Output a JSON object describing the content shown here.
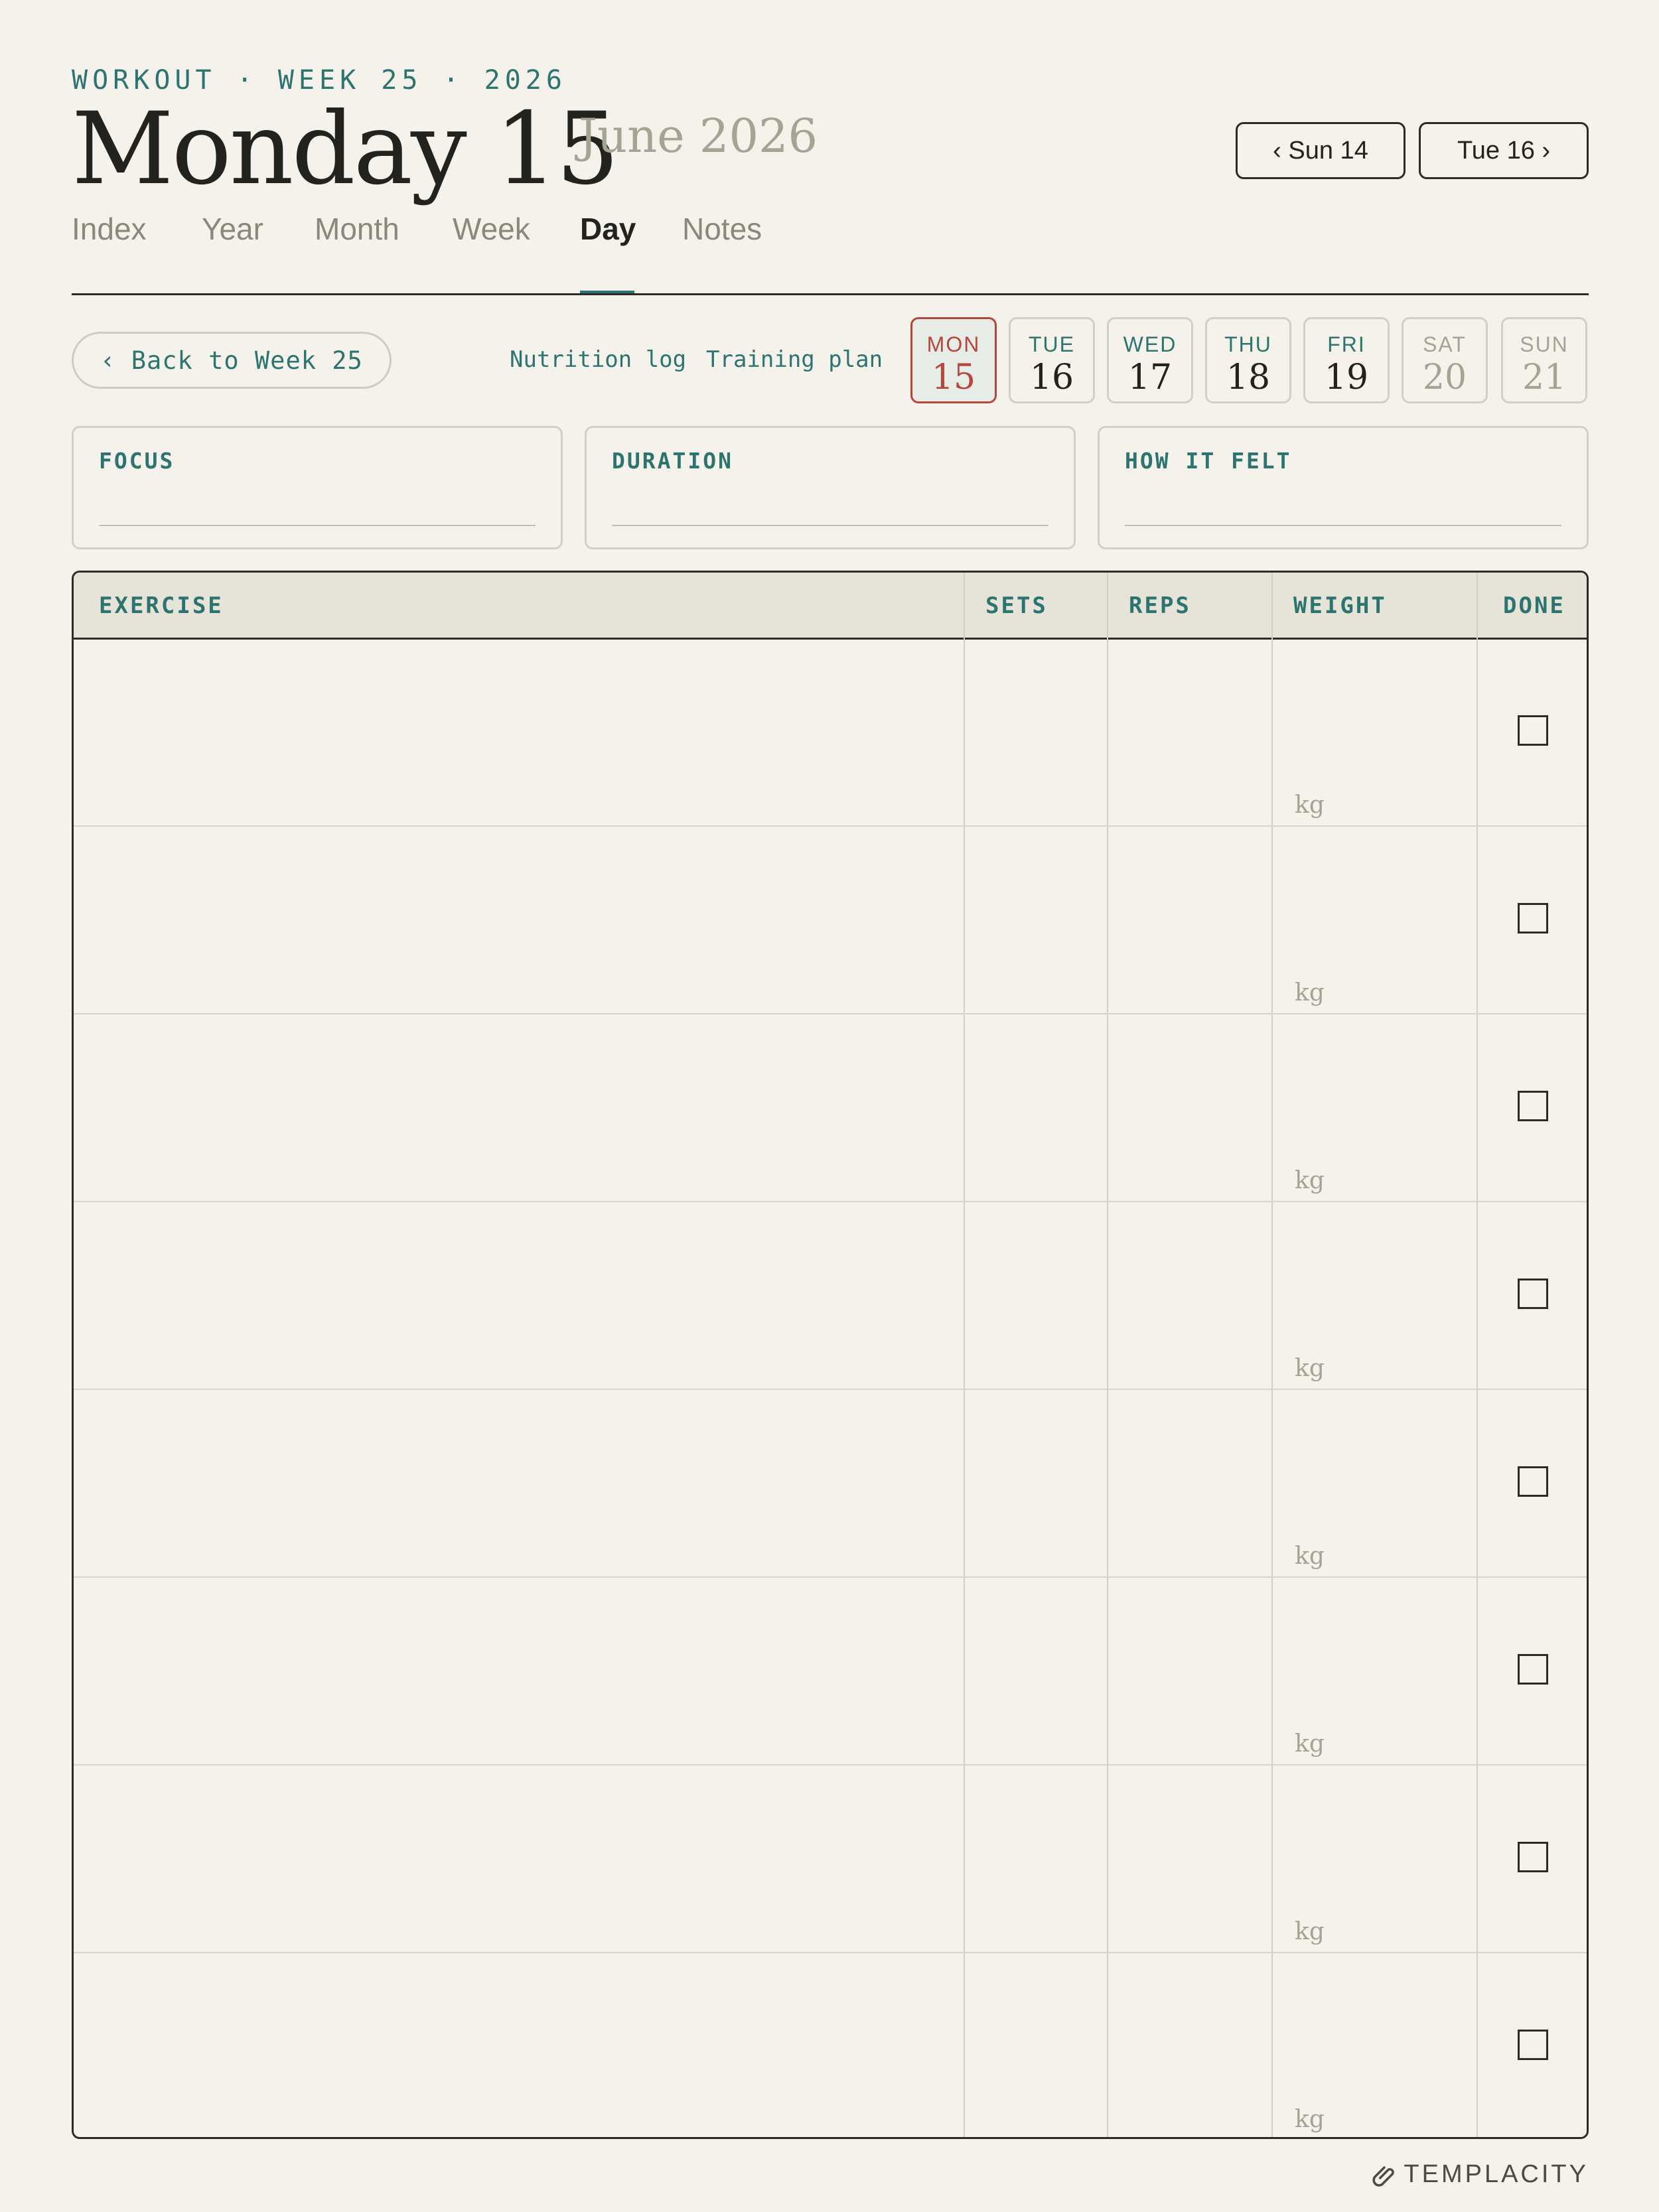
{
  "header": {
    "kicker": "WORKOUT · WEEK 25 · 2026",
    "title": "Monday 15",
    "subtitle": "June 2026",
    "prev_label": "‹ Sun 14",
    "next_label": "Tue 16 ›"
  },
  "tabs": [
    {
      "label": "Index"
    },
    {
      "label": "Year"
    },
    {
      "label": "Month"
    },
    {
      "label": "Week"
    },
    {
      "label": "Day",
      "active": true
    },
    {
      "label": "Notes"
    }
  ],
  "toolbar": {
    "back_label": "‹ Back to Week 25",
    "links": [
      "Nutrition log",
      "Training plan"
    ]
  },
  "days": [
    {
      "dow": "MON",
      "num": "15",
      "active": true
    },
    {
      "dow": "TUE",
      "num": "16"
    },
    {
      "dow": "WED",
      "num": "17"
    },
    {
      "dow": "THU",
      "num": "18"
    },
    {
      "dow": "FRI",
      "num": "19"
    },
    {
      "dow": "SAT",
      "num": "20",
      "weekend": true
    },
    {
      "dow": "SUN",
      "num": "21",
      "weekend": true
    }
  ],
  "fields": [
    {
      "label": "FOCUS",
      "value": ""
    },
    {
      "label": "DURATION",
      "value": ""
    },
    {
      "label": "HOW IT FELT",
      "value": ""
    }
  ],
  "table": {
    "columns": [
      "EXERCISE",
      "SETS",
      "REPS",
      "WEIGHT",
      "DONE"
    ],
    "unit": "kg",
    "rows": [
      {
        "exercise": "",
        "sets": "",
        "reps": "",
        "weight": "",
        "done": false
      },
      {
        "exercise": "",
        "sets": "",
        "reps": "",
        "weight": "",
        "done": false
      },
      {
        "exercise": "",
        "sets": "",
        "reps": "",
        "weight": "",
        "done": false
      },
      {
        "exercise": "",
        "sets": "",
        "reps": "",
        "weight": "",
        "done": false
      },
      {
        "exercise": "",
        "sets": "",
        "reps": "",
        "weight": "",
        "done": false
      },
      {
        "exercise": "",
        "sets": "",
        "reps": "",
        "weight": "",
        "done": false
      },
      {
        "exercise": "",
        "sets": "",
        "reps": "",
        "weight": "",
        "done": false
      },
      {
        "exercise": "",
        "sets": "",
        "reps": "",
        "weight": "",
        "done": false
      }
    ]
  },
  "brand": {
    "name": "TEMPLACITY",
    "icon": "paperclip-icon"
  },
  "colors": {
    "accent": "#2d7470",
    "today": "#b5473c",
    "paper": "#f4f2ea",
    "ink": "#22221f"
  }
}
